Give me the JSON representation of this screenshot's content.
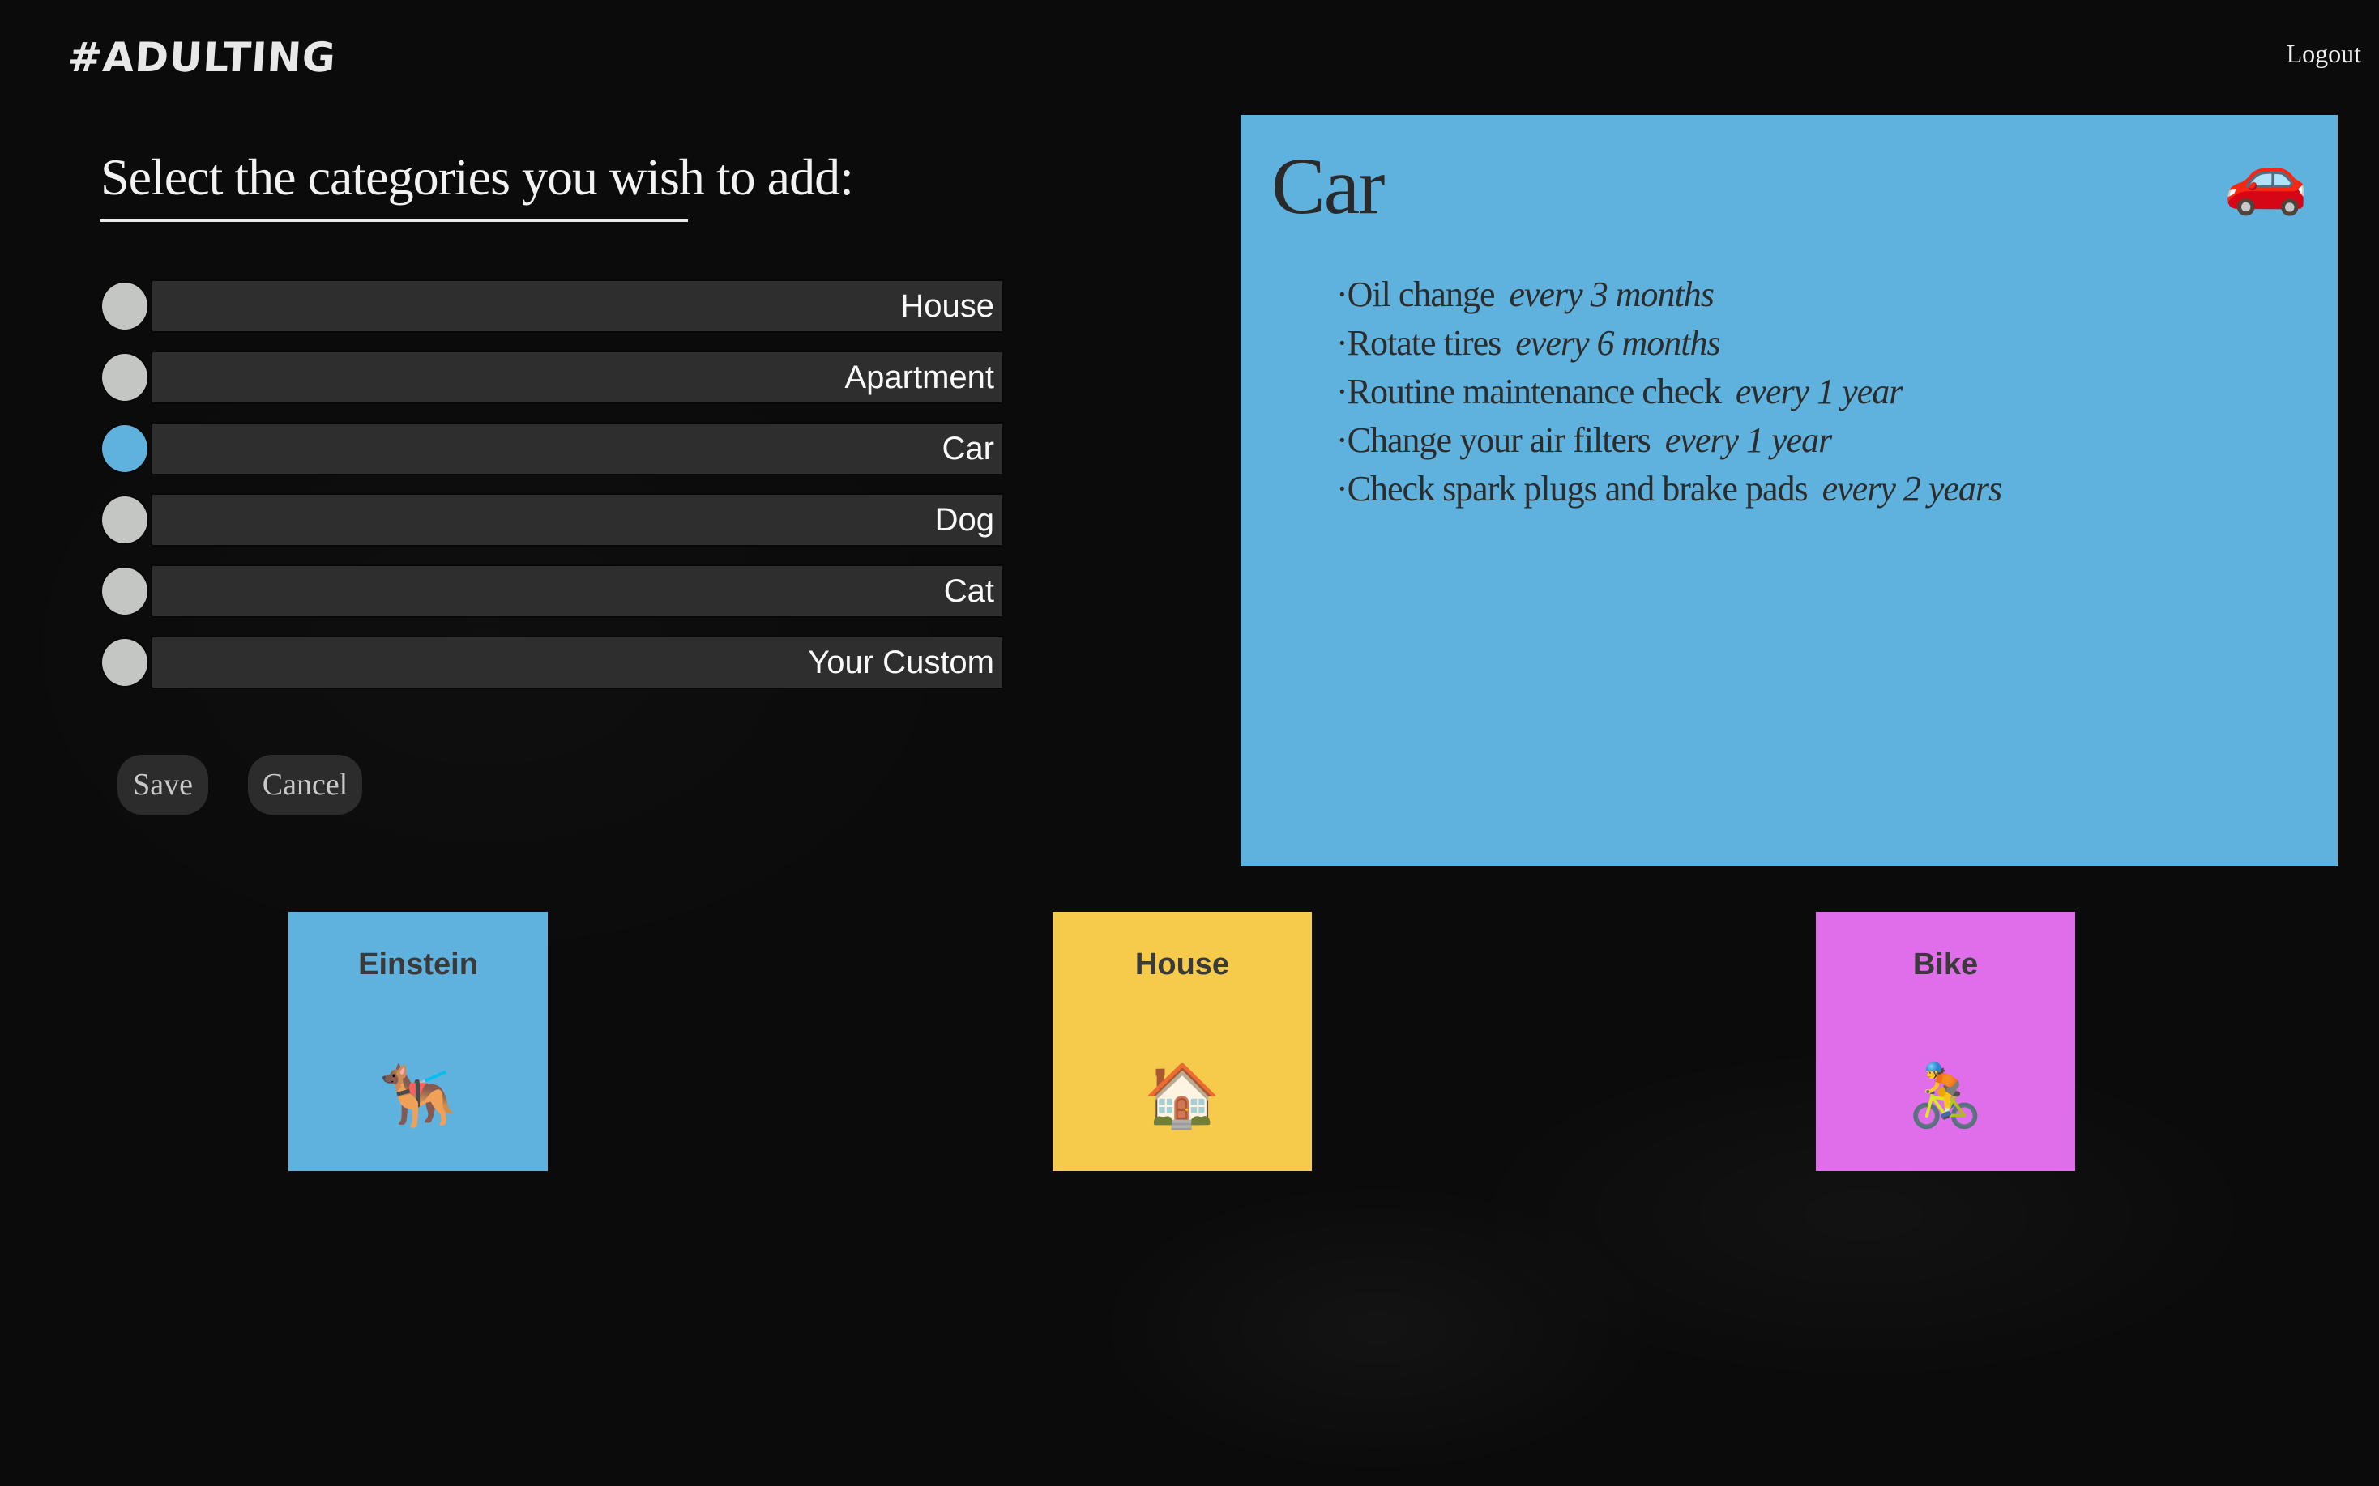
{
  "header": {
    "logo": "#ADULTING",
    "logout_label": "Logout"
  },
  "selector": {
    "heading": "Select the categories you wish to add:",
    "categories": [
      {
        "label": "House",
        "selected": false
      },
      {
        "label": "Apartment",
        "selected": false
      },
      {
        "label": "Car",
        "selected": true
      },
      {
        "label": "Dog",
        "selected": false
      },
      {
        "label": "Cat",
        "selected": false
      },
      {
        "label": "Your Custom",
        "selected": false
      }
    ],
    "save_label": "Save",
    "cancel_label": "Cancel",
    "selected_color": "#5fb1de",
    "unselected_color": "#c4c6c3"
  },
  "detail_panel": {
    "title": "Car",
    "icon": "car-icon",
    "emoji": "🚗",
    "color": "#5fb2dd",
    "tasks": [
      {
        "bullet": "·",
        "name": "Oil change",
        "frequency": "every 3 months"
      },
      {
        "bullet": "·",
        "name": "Rotate tires",
        "frequency": "every 6 months"
      },
      {
        "bullet": "·",
        "name": "Routine maintenance check",
        "frequency": "every 1 year"
      },
      {
        "bullet": "·",
        "name": "Change your air filters",
        "frequency": "every 1 year"
      },
      {
        "bullet": "·",
        "name": "Check spark plugs and brake pads",
        "frequency": "every 2 years"
      }
    ]
  },
  "tiles": [
    {
      "name": "Einstein",
      "icon": "service-dog-icon",
      "emoji": "🐕‍🦺",
      "color": "#5fb2dd"
    },
    {
      "name": "House",
      "icon": "house-icon",
      "emoji": "🏠",
      "color": "#f6cb4b"
    },
    {
      "name": "Bike",
      "icon": "cyclist-icon",
      "emoji": "🚴",
      "color": "#e06dea"
    }
  ]
}
